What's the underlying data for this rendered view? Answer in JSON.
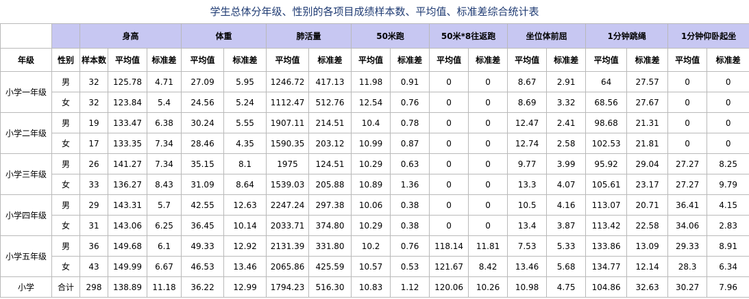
{
  "title": "学生总体分年级、性别的各项目成绩样本数、平均值、标准差综合统计表",
  "header": {
    "grade": "年级",
    "gender": "性别",
    "sample": "样本数",
    "mean": "平均值",
    "sd": "标准差",
    "items": [
      "身高",
      "体重",
      "肺活量",
      "50米跑",
      "50米*8往返跑",
      "坐位体前屈",
      "1分钟跳绳",
      "1分钟仰卧起坐"
    ]
  },
  "groups": [
    {
      "grade": "小学一年级",
      "rows": [
        {
          "gender": "男",
          "cells": [
            "32",
            "125.78",
            "4.71",
            "27.09",
            "5.95",
            "1246.72",
            "417.13",
            "11.98",
            "0.91",
            "0",
            "0",
            "8.67",
            "2.91",
            "64",
            "27.57",
            "0",
            "0"
          ]
        },
        {
          "gender": "女",
          "cells": [
            "32",
            "123.84",
            "5.4",
            "24.56",
            "5.24",
            "1112.47",
            "512.76",
            "12.54",
            "0.76",
            "0",
            "0",
            "8.69",
            "3.32",
            "68.56",
            "27.67",
            "0",
            "0"
          ]
        }
      ]
    },
    {
      "grade": "小学二年级",
      "rows": [
        {
          "gender": "男",
          "cells": [
            "19",
            "133.47",
            "6.38",
            "30.24",
            "5.55",
            "1907.11",
            "214.51",
            "10.4",
            "0.78",
            "0",
            "0",
            "12.47",
            "2.41",
            "98.68",
            "21.31",
            "0",
            "0"
          ]
        },
        {
          "gender": "女",
          "cells": [
            "17",
            "133.35",
            "7.34",
            "28.46",
            "4.35",
            "1590.35",
            "203.12",
            "10.99",
            "0.87",
            "0",
            "0",
            "12.74",
            "2.58",
            "102.53",
            "21.81",
            "0",
            "0"
          ]
        }
      ]
    },
    {
      "grade": "小学三年级",
      "rows": [
        {
          "gender": "男",
          "cells": [
            "26",
            "141.27",
            "7.34",
            "35.15",
            "8.1",
            "1975",
            "124.51",
            "10.29",
            "0.63",
            "0",
            "0",
            "9.77",
            "3.99",
            "95.92",
            "29.04",
            "27.27",
            "8.25"
          ]
        },
        {
          "gender": "女",
          "cells": [
            "33",
            "136.27",
            "8.43",
            "31.09",
            "8.64",
            "1539.03",
            "205.88",
            "10.89",
            "1.36",
            "0",
            "0",
            "13.3",
            "4.07",
            "105.61",
            "23.17",
            "27.27",
            "9.79"
          ]
        }
      ]
    },
    {
      "grade": "小学四年级",
      "rows": [
        {
          "gender": "男",
          "cells": [
            "29",
            "143.31",
            "5.7",
            "42.55",
            "12.63",
            "2247.24",
            "297.38",
            "10.06",
            "0.38",
            "0",
            "0",
            "10.5",
            "4.16",
            "113.07",
            "20.71",
            "36.41",
            "4.15"
          ]
        },
        {
          "gender": "女",
          "cells": [
            "31",
            "143.06",
            "6.25",
            "36.45",
            "10.14",
            "2033.71",
            "374.80",
            "10.29",
            "0.38",
            "0",
            "0",
            "13.4",
            "3.87",
            "113.42",
            "22.58",
            "34.06",
            "2.83"
          ]
        }
      ]
    },
    {
      "grade": "小学五年级",
      "rows": [
        {
          "gender": "男",
          "cells": [
            "36",
            "149.68",
            "6.1",
            "49.33",
            "12.92",
            "2131.39",
            "331.80",
            "10.2",
            "0.76",
            "118.14",
            "11.81",
            "7.53",
            "5.33",
            "133.86",
            "13.09",
            "29.33",
            "8.91"
          ]
        },
        {
          "gender": "女",
          "cells": [
            "43",
            "149.99",
            "6.67",
            "46.53",
            "13.46",
            "2065.86",
            "425.59",
            "10.57",
            "0.53",
            "121.67",
            "8.42",
            "13.46",
            "5.68",
            "134.77",
            "12.14",
            "28.3",
            "6.34"
          ]
        }
      ]
    }
  ],
  "total": {
    "grade": "小学",
    "gender": "合计",
    "cells": [
      "298",
      "138.89",
      "11.18",
      "36.22",
      "12.99",
      "1794.23",
      "516.30",
      "10.83",
      "1.12",
      "120.06",
      "10.26",
      "10.98",
      "4.75",
      "104.86",
      "32.63",
      "30.27",
      "7.96"
    ]
  }
}
